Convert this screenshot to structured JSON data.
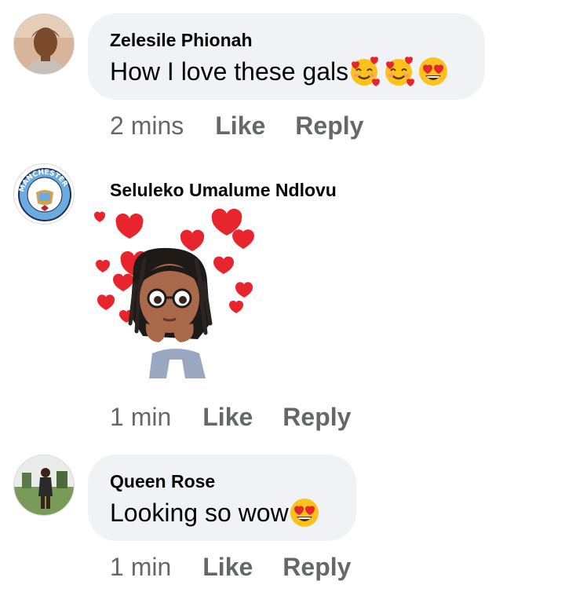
{
  "comments": [
    {
      "author": "Zelesile Phionah",
      "text": "How I love these gals",
      "emojis": [
        "smiling-face-with-hearts",
        "smiling-face-with-hearts",
        "heart-eyes"
      ],
      "time": "2 mins",
      "like_label": "Like",
      "reply_label": "Reply"
    },
    {
      "author": "Seluleko Umalume Ndlovu",
      "avatar_text": "MANCHESTER",
      "sticker": "avatar-sticker-with-hearts",
      "time": "1 min",
      "like_label": "Like",
      "reply_label": "Reply"
    },
    {
      "author": "Queen Rose",
      "text": "Looking so wow",
      "emojis": [
        "heart-eyes"
      ],
      "time": "1 min",
      "like_label": "Like",
      "reply_label": "Reply"
    }
  ],
  "colors": {
    "bubble": "#f0f2f5",
    "meta_text": "#65676b",
    "heart": "#e8252c",
    "emoji_face": "#fcc21b"
  }
}
